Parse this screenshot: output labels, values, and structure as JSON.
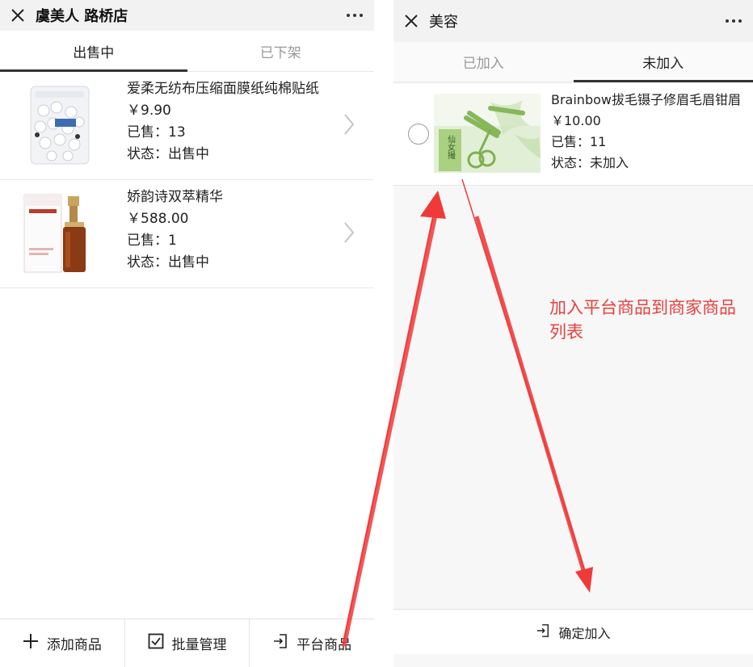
{
  "left_window": {
    "title": "虞美人 路桥店",
    "tabs": [
      {
        "label": "出售中",
        "active": true
      },
      {
        "label": "已下架",
        "active": false
      }
    ],
    "products": [
      {
        "name": "爱柔无纺布压缩面膜纸纯棉贴纸",
        "price": "￥9.90",
        "sold": "已售：13",
        "status": "状态：出售中"
      },
      {
        "name": "娇韵诗双萃精华",
        "price": "￥588.00",
        "sold": "已售：1",
        "status": "状态：出售中"
      }
    ],
    "bottom_buttons": [
      {
        "label": "添加商品",
        "icon": "plus-icon"
      },
      {
        "label": "批量管理",
        "icon": "checkbox-icon"
      },
      {
        "label": "平台商品",
        "icon": "enter-icon"
      }
    ]
  },
  "right_window": {
    "title": "美容",
    "tabs": [
      {
        "label": "已加入",
        "active": false
      },
      {
        "label": "未加入",
        "active": true
      }
    ],
    "products": [
      {
        "name": "Brainbow拔毛镊子修眉毛眉钳眉",
        "price": "￥10.00",
        "sold": "已售：11",
        "status": "状态：未加入",
        "selected": false
      }
    ],
    "confirm_label": "确定加入",
    "thumb_caption": "仙女撮"
  },
  "annotation": {
    "text": "加入平台商品到商家商品列表",
    "color": "#e8403f"
  },
  "colors": {
    "titlebar": "#f2f2f2",
    "tab_active_underline": "#333333",
    "arrow": "#f03a3a"
  }
}
